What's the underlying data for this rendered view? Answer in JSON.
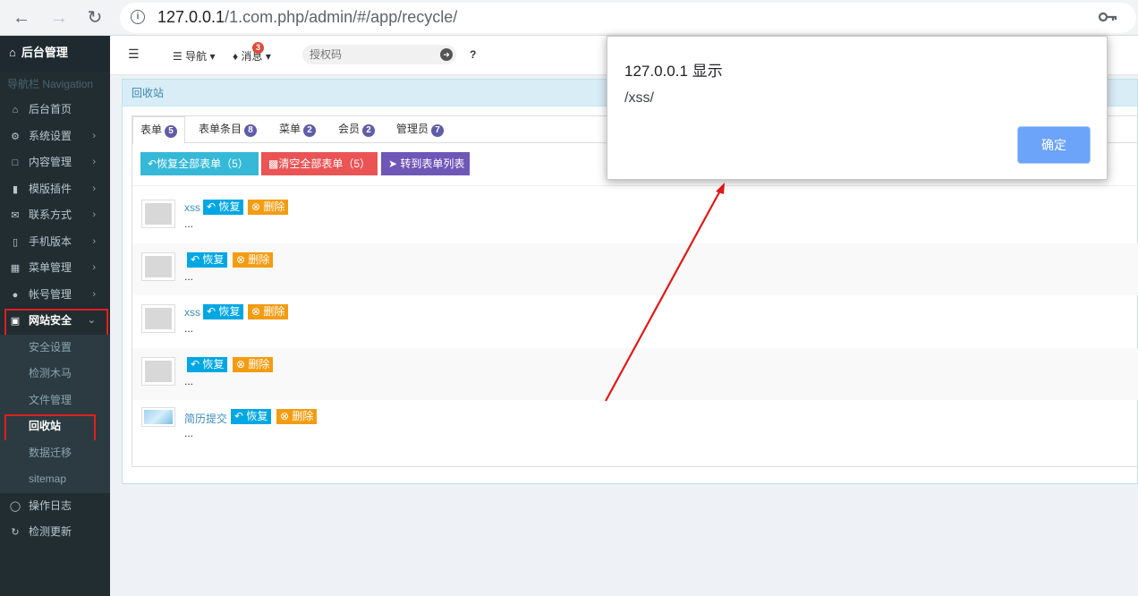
{
  "browser": {
    "url_host": "127.0.0.1",
    "url_path": "/1.com.php/admin/#/app/recycle/"
  },
  "sidebar": {
    "brand": "后台管理",
    "header": "导航栏 Navigation",
    "items": [
      {
        "label": "后台首页",
        "icon": "home-icon"
      },
      {
        "label": "系统设置",
        "icon": "gear-icon"
      },
      {
        "label": "内容管理",
        "icon": "file-icon"
      },
      {
        "label": "模版插件",
        "icon": "bookmark-icon"
      },
      {
        "label": "联系方式",
        "icon": "envelope-icon"
      },
      {
        "label": "手机版本",
        "icon": "mobile-icon"
      },
      {
        "label": "菜单管理",
        "icon": "grid-icon"
      },
      {
        "label": "帐号管理",
        "icon": "user-icon"
      },
      {
        "label": "网站安全",
        "icon": "lock-icon"
      }
    ],
    "sub_items": [
      "安全设置",
      "检测木马",
      "文件管理",
      "回收站",
      "数据迁移",
      "sitemap"
    ],
    "bottom_items": [
      {
        "label": "操作日志",
        "icon": "clock-icon"
      },
      {
        "label": "检测更新",
        "icon": "refresh-icon"
      }
    ]
  },
  "header": {
    "nav_label": "导航",
    "msg_label": "消息",
    "msg_count": "3",
    "search_placeholder": "授权码",
    "help": "?"
  },
  "panel": {
    "title": "回收站"
  },
  "tabs": [
    {
      "label": "表单",
      "count": "5"
    },
    {
      "label": "表单条目",
      "count": "8"
    },
    {
      "label": "菜单",
      "count": "2"
    },
    {
      "label": "会员",
      "count": "2"
    },
    {
      "label": "管理员",
      "count": "7"
    }
  ],
  "actions": {
    "restore_all": "恢复全部表单（5）",
    "clear_all": "清空全部表单（5）",
    "goto_list": "转到表单列表",
    "colors": {
      "restore": "#36b9d7",
      "clear": "#ea5455",
      "goto": "#6f57b8"
    }
  },
  "rows": [
    {
      "name": "xss",
      "dots": "...",
      "thumb": "placeholder"
    },
    {
      "name": "",
      "dots": "...",
      "thumb": "placeholder"
    },
    {
      "name": "xss",
      "dots": "...",
      "thumb": "placeholder"
    },
    {
      "name": "",
      "dots": "...",
      "thumb": "placeholder"
    },
    {
      "name": "简历提交",
      "dots": "...",
      "thumb": "image"
    }
  ],
  "row_buttons": {
    "restore": "恢复",
    "delete": "删除"
  },
  "dialog": {
    "title": "127.0.0.1 显示",
    "message": "/xss/",
    "ok": "确定"
  }
}
